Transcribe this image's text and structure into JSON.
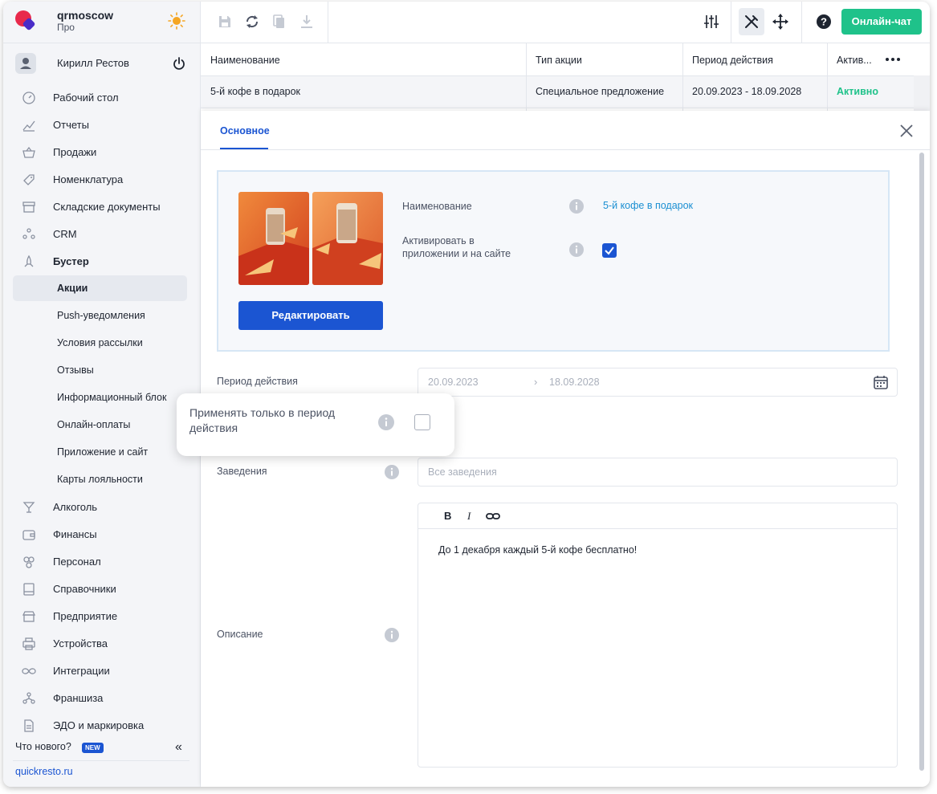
{
  "brand": {
    "name": "qrmoscow",
    "plan": "Про"
  },
  "user": {
    "name": "Кирилл Рестов"
  },
  "menu": [
    {
      "label": "Рабочий стол",
      "icon": "speedometer-icon"
    },
    {
      "label": "Отчеты",
      "icon": "chart-icon"
    },
    {
      "label": "Продажи",
      "icon": "basket-icon"
    },
    {
      "label": "Номенклатура",
      "icon": "tag-icon"
    },
    {
      "label": "Складские документы",
      "icon": "archive-icon"
    },
    {
      "label": "CRM",
      "icon": "people-icon"
    },
    {
      "label": "Бустер",
      "icon": "rocket-icon"
    }
  ],
  "submenu": [
    {
      "label": "Акции"
    },
    {
      "label": "Push-уведомления"
    },
    {
      "label": "Условия рассылки"
    },
    {
      "label": "Отзывы"
    },
    {
      "label": "Информационный блок"
    },
    {
      "label": "Онлайн-оплаты"
    },
    {
      "label": "Приложение и сайт"
    },
    {
      "label": "Карты лояльности"
    }
  ],
  "menu2": [
    {
      "label": "Алкоголь",
      "icon": "glass-icon"
    },
    {
      "label": "Финансы",
      "icon": "wallet-icon"
    },
    {
      "label": "Персонал",
      "icon": "staff-icon"
    },
    {
      "label": "Справочники",
      "icon": "book-icon"
    },
    {
      "label": "Предприятие",
      "icon": "store-icon"
    },
    {
      "label": "Устройства",
      "icon": "printer-icon"
    },
    {
      "label": "Интеграции",
      "icon": "infinity-icon"
    },
    {
      "label": "Франшиза",
      "icon": "franchise-icon"
    },
    {
      "label": "ЭДО и маркировка",
      "icon": "document-icon"
    }
  ],
  "footer": {
    "whats_new": "Что нового?",
    "new_badge": "NEW",
    "site": "quickresto.ru"
  },
  "toolbar": {
    "chat_label": "Онлайн-чат"
  },
  "table": {
    "headers": [
      "Наименование",
      "Тип акции",
      "Период действия",
      "Актив..."
    ],
    "row": [
      "5-й кофе в подарок",
      "Специальное предложение",
      "20.09.2023 - 18.09.2028",
      "Активно"
    ]
  },
  "panel": {
    "tab": "Основное",
    "card": {
      "name_label": "Наименование",
      "name_value": "5-й кофе в подарок",
      "activate_label": "Активировать в приложении и на сайте",
      "activate_checked": true,
      "edit_button": "Редактировать"
    },
    "period": {
      "label": "Период действия",
      "from": "20.09.2023",
      "to": "18.09.2028"
    },
    "popover": {
      "label": "Применять только в период действия",
      "checked": false
    },
    "venues": {
      "label": "Заведения",
      "placeholder": "Все заведения"
    },
    "description": {
      "label": "Описание",
      "text": "До 1 декабря каждый 5-й кофе бесплатно!"
    }
  },
  "colors": {
    "accent": "#1b55d2",
    "success": "#1fc28a",
    "link": "#1b8fd2"
  }
}
